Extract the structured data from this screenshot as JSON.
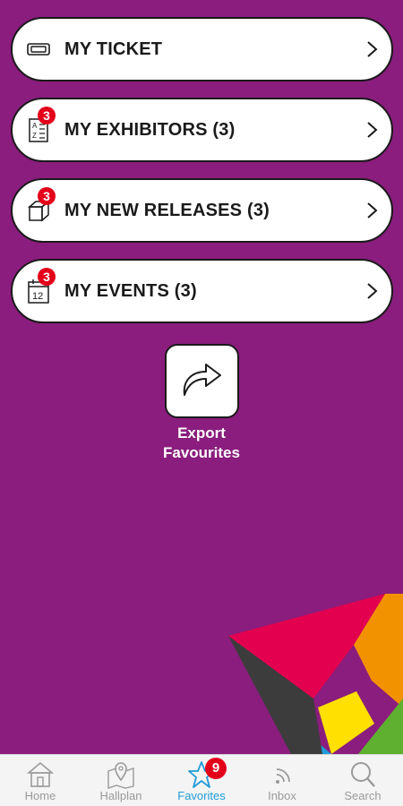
{
  "menu": {
    "ticket": {
      "label": "MY TICKET"
    },
    "exhibitors": {
      "label": "MY EXHIBITORS (3)",
      "badge": "3"
    },
    "new_releases": {
      "label": "MY NEW RELEASES (3)",
      "badge": "3"
    },
    "events": {
      "label": "MY EVENTS (3)",
      "badge": "3",
      "calendar_day": "12"
    }
  },
  "export": {
    "line1": "Export",
    "line2": "Favourites"
  },
  "tabbar": {
    "home": {
      "label": "Home",
      "icon": "home-icon"
    },
    "hallplan": {
      "label": "Hallplan",
      "icon": "map-pin-icon"
    },
    "favorites": {
      "label": "Favorites",
      "icon": "star-icon",
      "badge": "9",
      "active": true
    },
    "inbox": {
      "label": "Inbox",
      "icon": "rss-icon"
    },
    "search": {
      "label": "Search",
      "icon": "search-icon"
    }
  },
  "colors": {
    "background": "#8a1d7d",
    "badge": "#e3001b",
    "active_tab": "#1f9bd7",
    "inactive_tab": "#9a9a9a"
  }
}
